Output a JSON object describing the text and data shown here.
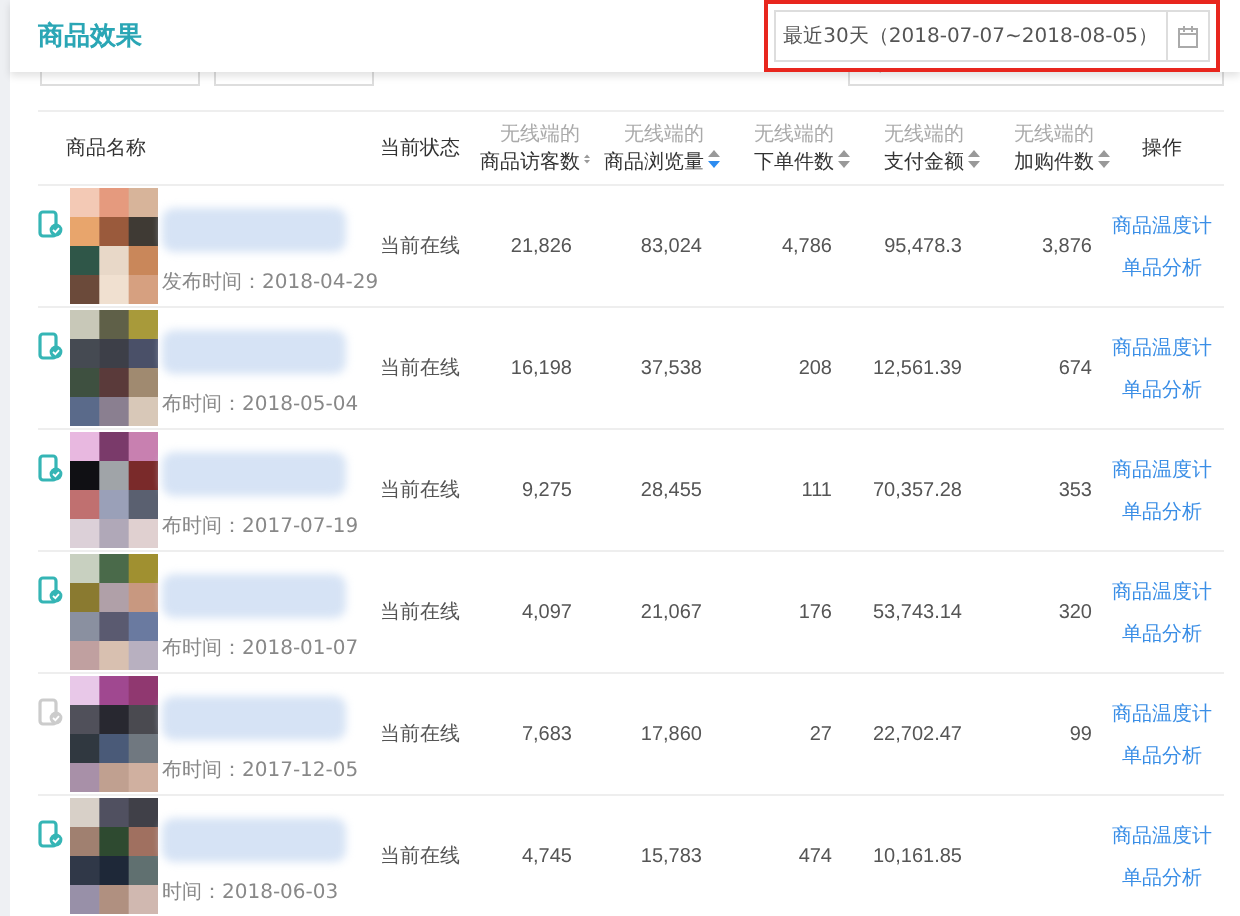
{
  "header": {
    "title": "商品效果",
    "date_range": "最近30天（2018-07-07~2018-08-05）",
    "highlighted": true
  },
  "table": {
    "columns": [
      {
        "label": "商品名称",
        "kind": "plain"
      },
      {
        "label": "当前状态",
        "kind": "plain"
      },
      {
        "prefix": "无线端的",
        "label": "商品访客数",
        "kind": "sortable",
        "sorted": false
      },
      {
        "prefix": "无线端的",
        "label": "商品浏览量",
        "kind": "sortable",
        "sorted": true
      },
      {
        "prefix": "无线端的",
        "label": "下单件数",
        "kind": "sortable",
        "sorted": false
      },
      {
        "prefix": "无线端的",
        "label": "支付金额",
        "kind": "sortable",
        "sorted": false
      },
      {
        "prefix": "无线端的",
        "label": "加购件数",
        "kind": "sortable",
        "sorted": false
      },
      {
        "label": "操作",
        "kind": "plain"
      }
    ],
    "rows": [
      {
        "mobile_active": true,
        "published": "发布时间：2018-04-29",
        "status": "当前在线",
        "values": [
          "21,826",
          "83,024",
          "4,786",
          "95,478.3",
          "3,876"
        ],
        "actions": [
          "商品温度计",
          "单品分析"
        ]
      },
      {
        "mobile_active": true,
        "published": "布时间：2018-05-04",
        "status": "当前在线",
        "values": [
          "16,198",
          "37,538",
          "208",
          "12,561.39",
          "674"
        ],
        "actions": [
          "商品温度计",
          "单品分析"
        ]
      },
      {
        "mobile_active": true,
        "published": "布时间：2017-07-19",
        "status": "当前在线",
        "values": [
          "9,275",
          "28,455",
          "111",
          "70,357.28",
          "353"
        ],
        "actions": [
          "商品温度计",
          "单品分析"
        ]
      },
      {
        "mobile_active": true,
        "published": "布时间：2018-01-07",
        "status": "当前在线",
        "values": [
          "4,097",
          "21,067",
          "176",
          "53,743.14",
          "320"
        ],
        "actions": [
          "商品温度计",
          "单品分析"
        ]
      },
      {
        "mobile_active": false,
        "published": "布时间：2017-12-05",
        "status": "当前在线",
        "values": [
          "7,683",
          "17,860",
          "27",
          "22,702.47",
          "99"
        ],
        "actions": [
          "商品温度计",
          "单品分析"
        ]
      },
      {
        "mobile_active": true,
        "published": "时间：2018-06-03",
        "status": "当前在线",
        "values": [
          "4,745",
          "15,783",
          "474",
          "10,161.85"
        ],
        "actions": [
          "商品温度计",
          "单品分析"
        ]
      }
    ]
  }
}
